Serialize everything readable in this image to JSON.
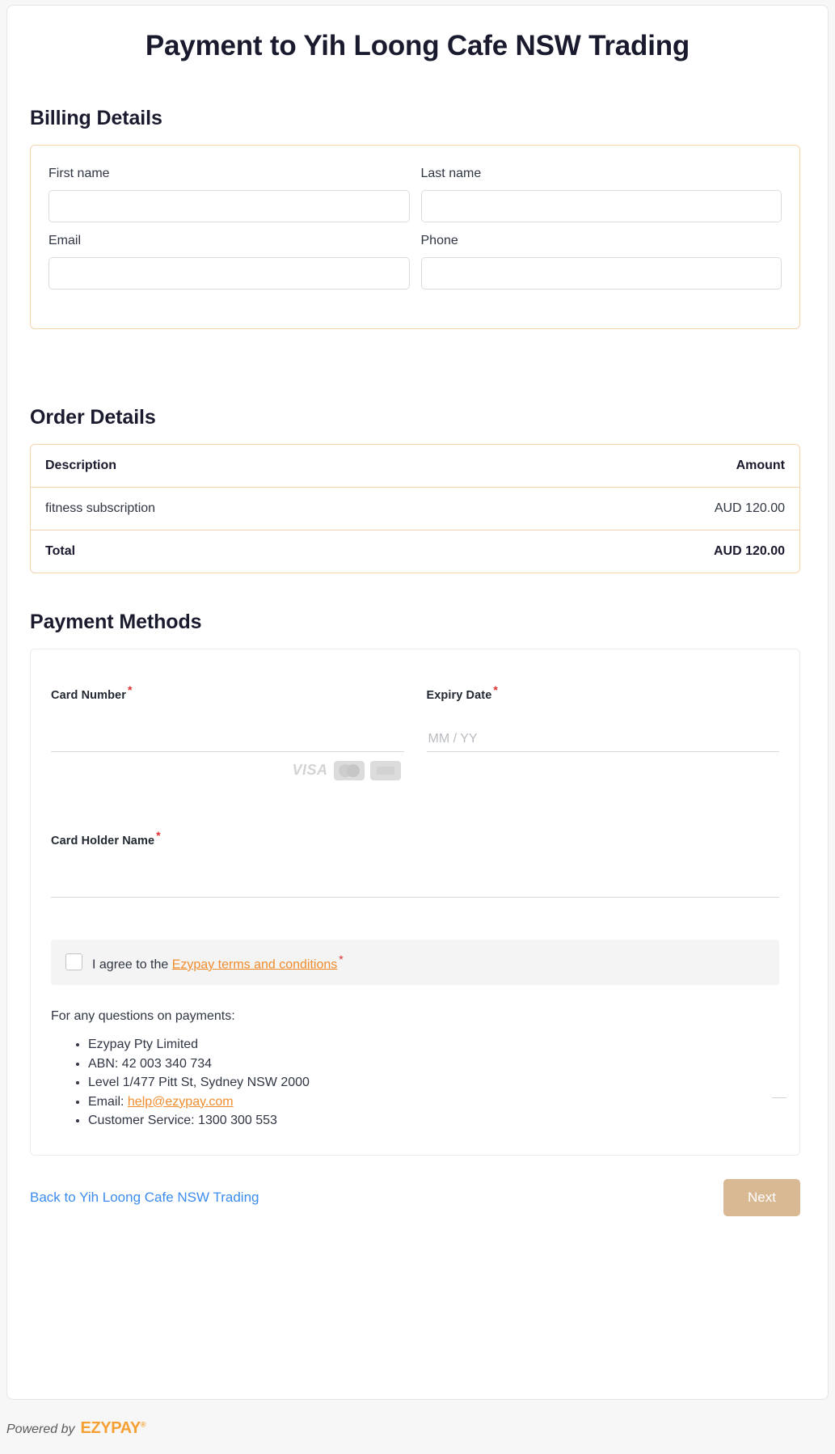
{
  "page": {
    "title": "Payment to Yih Loong Cafe NSW Trading"
  },
  "billing": {
    "heading": "Billing Details",
    "fields": [
      {
        "label": "First name",
        "value": "",
        "placeholder": ""
      },
      {
        "label": "Last name",
        "value": "",
        "placeholder": ""
      },
      {
        "label": "Email",
        "value": "",
        "placeholder": ""
      },
      {
        "label": "Phone",
        "value": "",
        "placeholder": ""
      }
    ]
  },
  "order": {
    "heading": "Order Details",
    "columns": {
      "description": "Description",
      "amount": "Amount"
    },
    "items": [
      {
        "description": "fitness subscription",
        "amount": "AUD 120.00"
      }
    ],
    "total": {
      "label": "Total",
      "amount": "AUD 120.00"
    }
  },
  "payment": {
    "heading": "Payment Methods",
    "card_number": {
      "label": "Card Number",
      "required": "*",
      "value": "",
      "placeholder": ""
    },
    "expiry": {
      "label": "Expiry Date",
      "required": "*",
      "value": "",
      "placeholder": "MM / YY"
    },
    "card_holder": {
      "label": "Card Holder Name",
      "required": "*",
      "value": "",
      "placeholder": ""
    },
    "brands": [
      "VISA",
      "mastercard",
      "amex"
    ],
    "terms": {
      "prefix": "I agree to the ",
      "link": "Ezypay terms and conditions",
      "required": "*",
      "checked": false
    },
    "help": {
      "intro": "For any questions on payments:",
      "items": [
        "Ezypay Pty Limited",
        "ABN: 42 003 340 734",
        "Level 1/477 Pitt St, Sydney NSW 2000",
        "Email: help@ezypay.com",
        "Customer Service: 1300 300 553"
      ],
      "email_link": "help@ezypay.com",
      "email_prefix": "Email: "
    }
  },
  "footer": {
    "back_link": "Back to Yih Loong Cafe NSW Trading",
    "next_label": "Next",
    "powered_text": "Powered by",
    "powered_logo": "EZYPAY",
    "powered_reg": "®"
  },
  "colors": {
    "accent_orange": "#f08c2e",
    "panel_border": "#f6d3ad",
    "link_blue": "#3b8ced",
    "next_button": "#d9b894",
    "required_red": "#e03131"
  }
}
